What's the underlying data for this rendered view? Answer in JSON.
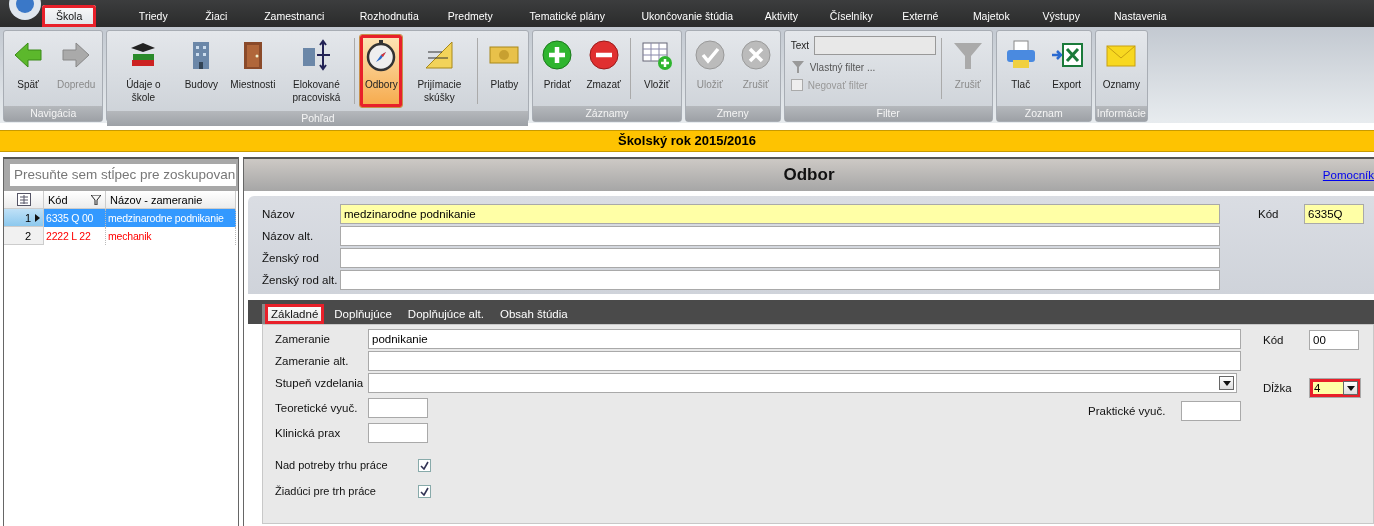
{
  "menu_tabs": [
    {
      "label": "Škola",
      "selected": true,
      "marked": true
    },
    {
      "label": "Triedy",
      "selected": false,
      "marked": false
    },
    {
      "label": "Žiaci",
      "selected": false,
      "marked": false
    },
    {
      "label": "Zamestnanci",
      "selected": false,
      "marked": false
    },
    {
      "label": "Rozhodnutia",
      "selected": false,
      "marked": false
    },
    {
      "label": "Predmety",
      "selected": false,
      "marked": false
    },
    {
      "label": "Tematické plány",
      "selected": false,
      "marked": false
    },
    {
      "label": "Ukončovanie štúdia",
      "selected": false,
      "marked": false
    },
    {
      "label": "Aktivity",
      "selected": false,
      "marked": false
    },
    {
      "label": "Číselníky",
      "selected": false,
      "marked": false
    },
    {
      "label": "Externé",
      "selected": false,
      "marked": false
    },
    {
      "label": "Majetok",
      "selected": false,
      "marked": false
    },
    {
      "label": "Výstupy",
      "selected": false,
      "marked": false
    },
    {
      "label": "Nastavenia",
      "selected": false,
      "marked": false
    }
  ],
  "ribbon_groups": [
    {
      "kind": "buttons",
      "title": "Navigácia",
      "items": [
        {
          "label": "Späť",
          "selected": false,
          "disabled": false,
          "marked": false
        },
        {
          "label": "Dopredu",
          "selected": false,
          "disabled": true,
          "marked": false
        }
      ]
    },
    {
      "kind": "buttons",
      "title": "Pohľad",
      "items": [
        {
          "label": "Údaje o škole",
          "selected": false,
          "disabled": false,
          "marked": false
        },
        {
          "label": "Budovy",
          "selected": false,
          "disabled": false,
          "marked": false
        },
        {
          "label": "Miestnosti",
          "selected": false,
          "disabled": false,
          "marked": false
        },
        {
          "label": "Elokované pracoviská",
          "selected": false,
          "disabled": false,
          "marked": false
        },
        {
          "label": "Odbory",
          "selected": true,
          "disabled": false,
          "marked": true
        },
        {
          "label": "Prijímacie skúšky",
          "selected": false,
          "disabled": false,
          "marked": false
        },
        {
          "label": "Platby",
          "selected": false,
          "disabled": false,
          "marked": false
        }
      ]
    },
    {
      "kind": "buttons",
      "title": "Záznamy",
      "items": [
        {
          "label": "Pridať",
          "selected": false,
          "disabled": false,
          "marked": false
        },
        {
          "label": "Zmazať",
          "selected": false,
          "disabled": false,
          "marked": false
        },
        {
          "label": "Vložiť",
          "selected": false,
          "disabled": false,
          "marked": false
        }
      ]
    },
    {
      "kind": "buttons",
      "title": "Zmeny",
      "items": [
        {
          "label": "Uložiť",
          "selected": false,
          "disabled": true,
          "marked": false
        },
        {
          "label": "Zrušiť",
          "selected": false,
          "disabled": true,
          "marked": false
        }
      ]
    },
    {
      "kind": "filter",
      "title": "Filter",
      "text_label": "Text",
      "custom_filter": "Vlastný filter ...",
      "negate": {
        "label": "Negovať filter",
        "checked": false,
        "disabled": true
      },
      "clear": {
        "label": "Zrušiť",
        "disabled": true
      }
    },
    {
      "kind": "buttons",
      "title": "Zoznam",
      "items": [
        {
          "label": "Tlač",
          "selected": false,
          "disabled": false,
          "marked": false
        },
        {
          "label": "Export",
          "selected": false,
          "disabled": false,
          "marked": false
        }
      ]
    },
    {
      "kind": "buttons",
      "title": "Informácie",
      "items": [
        {
          "label": "Oznamy",
          "selected": false,
          "disabled": false,
          "marked": false
        }
      ]
    }
  ],
  "school_year": "Školský rok 2015/2016",
  "grid": {
    "group_panel": "Presuňte sem stĺpec pre zoskupovan",
    "columns": [
      "Kód",
      "Názov - zameranie"
    ],
    "rows": [
      {
        "number": "1",
        "code": "6335 Q 00",
        "name": "medzinarodne podnikanie",
        "selected": true,
        "error": false
      },
      {
        "number": "2",
        "code": "2222 L 22",
        "name": "mechanik",
        "selected": false,
        "error": true
      }
    ]
  },
  "form": {
    "title": "Odbor",
    "help_link": "Pomocník",
    "fields": [
      {
        "label": "Názov",
        "value": "medzinarodne podnikanie",
        "highlighted": true
      },
      {
        "label": "Názov alt.",
        "highlighted": false
      },
      {
        "label": "Ženský rod",
        "highlighted": false
      },
      {
        "label": "Ženský rod alt.",
        "highlighted": false
      }
    ],
    "code": {
      "label": "Kód",
      "value": "6335Q",
      "highlighted": true
    },
    "tabs": [
      {
        "label": "Základné",
        "selected": true,
        "marked": true
      },
      {
        "label": "Doplňujúce",
        "selected": false,
        "marked": false
      },
      {
        "label": "Doplňujúce alt.",
        "selected": false,
        "marked": false
      },
      {
        "label": "Obsah štúdia",
        "selected": false,
        "marked": false
      }
    ],
    "specialization": {
      "label": "Zameranie",
      "value": "podnikanie"
    },
    "specialization_alt": {
      "label": "Zameranie alt."
    },
    "education_level": {
      "label": "Stupeň vzdelania"
    },
    "theory": {
      "label": "Teoretické vyuč."
    },
    "clinical": {
      "label": "Klinická prax"
    },
    "practice": {
      "label": "Praktické vyuč."
    },
    "sub_code": {
      "label": "Kód",
      "value": "00"
    },
    "length": {
      "label": "Dĺžka",
      "value": "4",
      "highlighted": true,
      "marked": true
    },
    "checks": [
      {
        "label": "Nad potreby trhu práce",
        "checked": true
      },
      {
        "label": "Žiadúci pre trh práce",
        "checked": true
      }
    ]
  }
}
